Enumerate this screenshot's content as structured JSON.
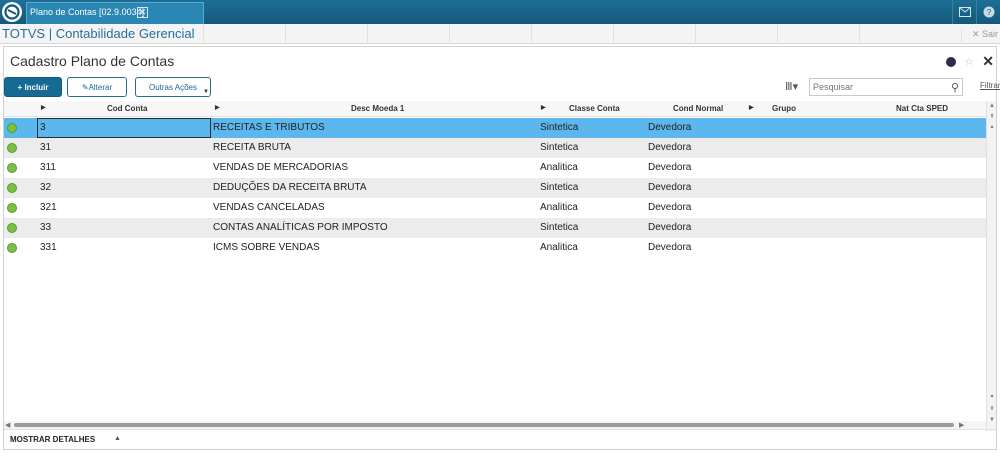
{
  "window": {
    "tab_label": "Plano de Contas [02.9.0034]",
    "tab_close": "✕",
    "app_title": "TOTVS | Contabilidade Gerencial",
    "sair_label": "Sair"
  },
  "panel": {
    "title": "Cadastro Plano de Contas",
    "close_glyph": "✕",
    "star_glyph": "☆"
  },
  "toolbar": {
    "incluir_label": "+ Incluir",
    "alterar_label": "Alterar",
    "outras_label": "Outras Ações",
    "search_placeholder": "Pesquisar",
    "filtrar_label": "Filtrar"
  },
  "grid": {
    "columns": [
      "Cod Conta",
      "Desc Moeda 1",
      "Classe Conta",
      "Cond Normal",
      "Grupo",
      "Nat Cta SPED"
    ],
    "rows": [
      {
        "cod": "3",
        "desc": "RECEITAS E TRIBUTOS",
        "classe": "Sintetica",
        "cond": "Devedora"
      },
      {
        "cod": "31",
        "desc": "RECEITA BRUTA",
        "classe": "Sintetica",
        "cond": "Devedora"
      },
      {
        "cod": "311",
        "desc": "VENDAS DE MERCADORIAS",
        "classe": "Analitica",
        "cond": "Devedora"
      },
      {
        "cod": "32",
        "desc": "DEDUÇÕES DA RECEITA BRUTA",
        "classe": "Sintetica",
        "cond": "Devedora"
      },
      {
        "cod": "321",
        "desc": "VENDAS CANCELADAS",
        "classe": "Analitica",
        "cond": "Devedora"
      },
      {
        "cod": "33",
        "desc": "CONTAS ANALÍTICAS POR IMPOSTO",
        "classe": "Sintetica",
        "cond": "Devedora"
      },
      {
        "cod": "331",
        "desc": "ICMS SOBRE VENDAS",
        "classe": "Analitica",
        "cond": "Devedora"
      }
    ]
  },
  "footer": {
    "detalhes_label": "MOSTRAR DETALHES"
  },
  "colors": {
    "brand": "#176a94",
    "selected_row": "#5cb7ee",
    "status_active": "#7ac142"
  }
}
